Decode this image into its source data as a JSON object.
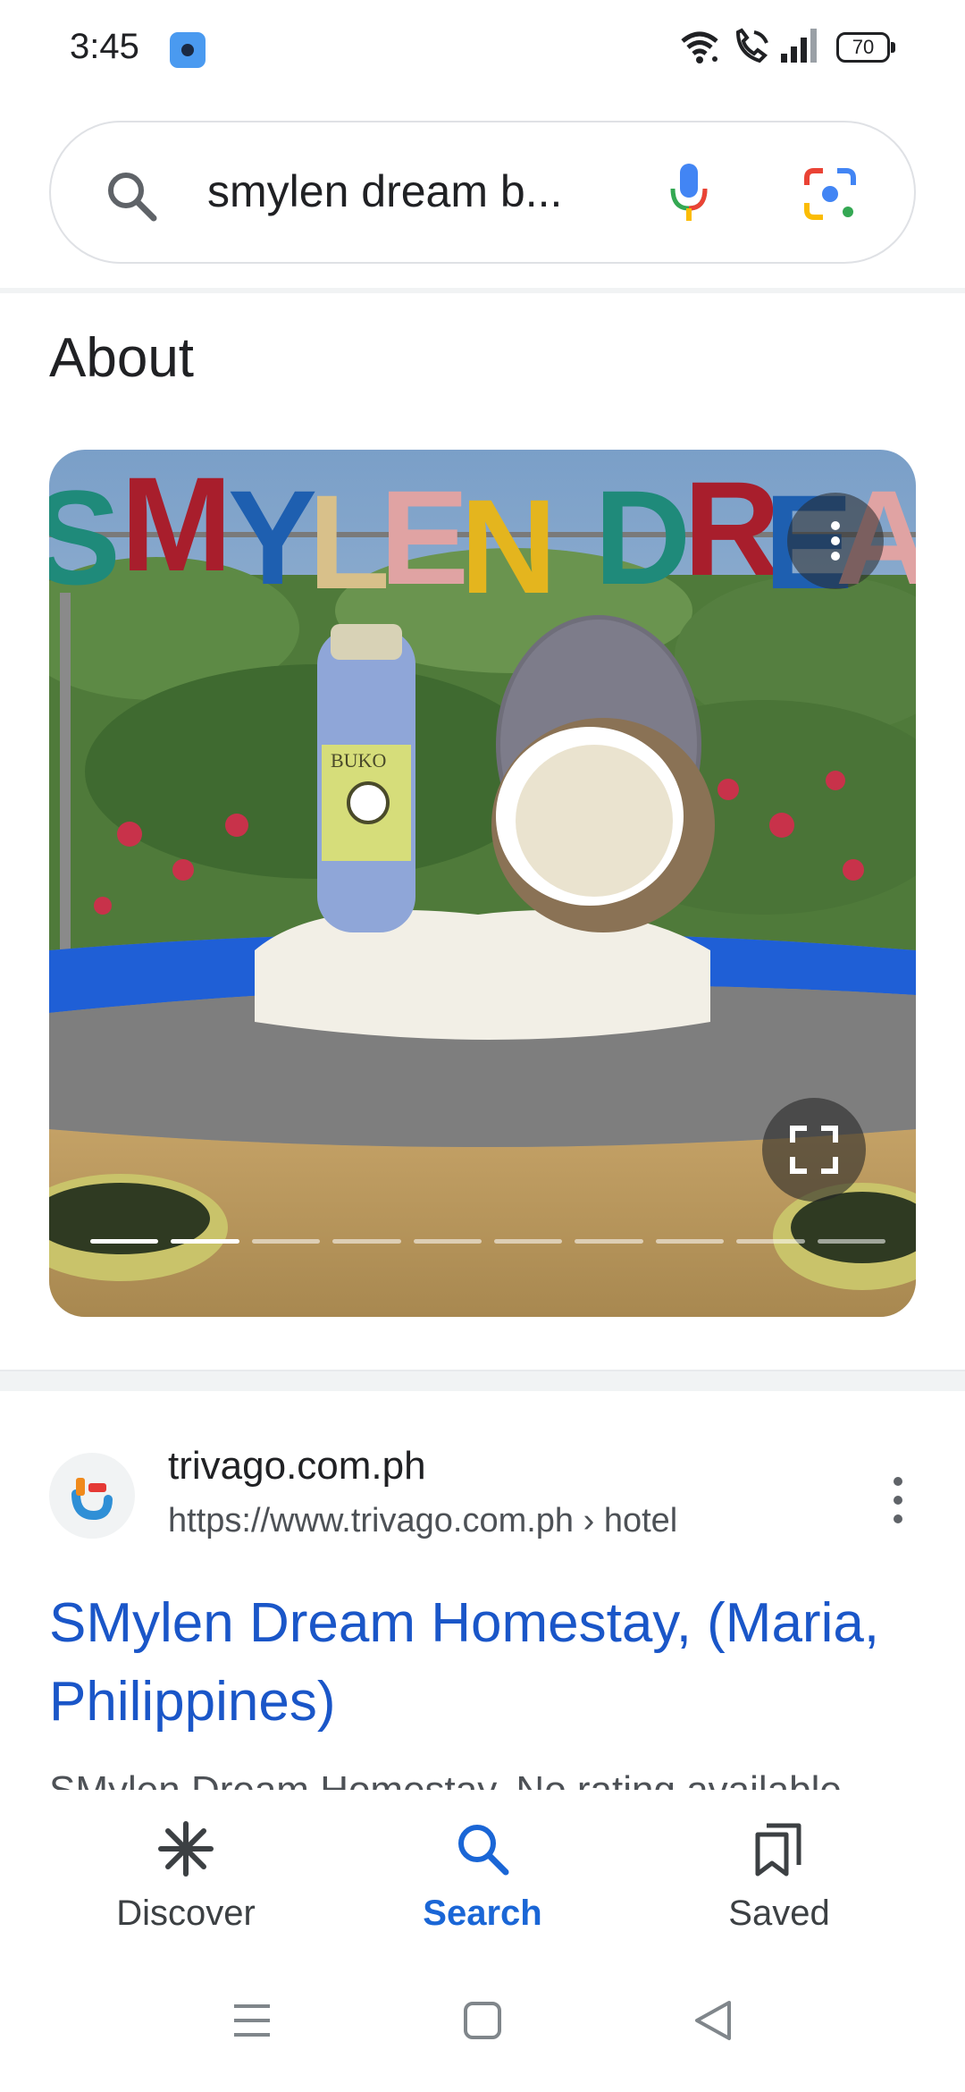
{
  "status_bar": {
    "time": "3:45",
    "battery": "70",
    "icons": [
      "app-icon",
      "wifi-icon",
      "wifi-call-icon",
      "signal-icon",
      "battery-icon"
    ]
  },
  "search": {
    "query": "smylen dream b...",
    "icons": [
      "search-icon",
      "mic-icon",
      "lens-icon"
    ]
  },
  "about": {
    "title": "About",
    "image_count": 10,
    "active_image_index": 1
  },
  "result": {
    "site_name": "trivago.com.ph",
    "url": "https://www.trivago.com.ph › hotel",
    "title": "SMylen Dream Homestay, (Maria, Philippines)",
    "snippet": "SMylen Dream Homestay. No rating available"
  },
  "bottom_nav": {
    "items": [
      {
        "label": "Discover",
        "icon": "discover-icon"
      },
      {
        "label": "Search",
        "icon": "search-icon"
      },
      {
        "label": "Saved",
        "icon": "saved-icon"
      }
    ],
    "active": "Search"
  },
  "colors": {
    "link": "#1a56c8",
    "accent": "#1a66d6"
  }
}
